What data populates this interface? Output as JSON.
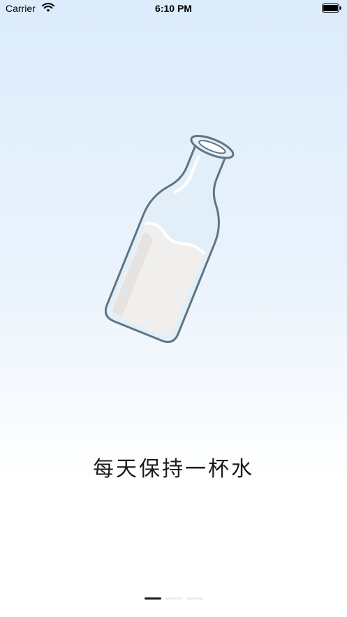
{
  "status_bar": {
    "carrier": "Carrier",
    "time": "6:10 PM",
    "wifi_icon": "wifi-icon",
    "battery_icon": "battery-icon"
  },
  "illustration": {
    "icon": "milk-bottle-icon"
  },
  "tagline": "每天保持一杯水",
  "page_indicator": {
    "total_pages": 3,
    "current_page": 1
  },
  "colors": {
    "background_top": "#dcecfb",
    "background_bottom": "#ffffff",
    "text": "#1a1a1a",
    "indicator_active": "#1a1a1a",
    "indicator_inactive": "#dff0f8"
  }
}
